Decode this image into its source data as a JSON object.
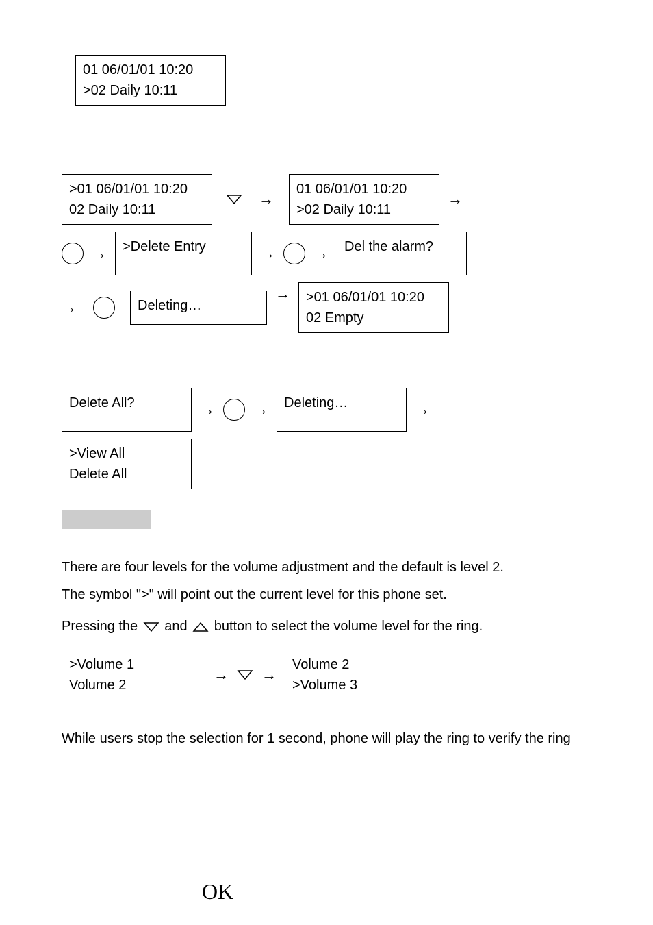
{
  "box_top": {
    "line1": "  01 06/01/01  10:20",
    "line2": ">02 Daily         10:11"
  },
  "flow1": {
    "b1_l1": ">01 06/01/01  10:20",
    "b1_l2": "  02 Daily        10:11",
    "b2_l1": "  01 06/01/01  10:20",
    "b2_l2": ">02 Daily 10:11"
  },
  "flow2": {
    "b1": ">Delete Entry",
    "b2": "Del the alarm?"
  },
  "flow3": {
    "b1": "Deleting…",
    "b2_l1": ">01 06/01/01  10:20",
    "b2_l2": "  02 Empty"
  },
  "flow4": {
    "b1": "Delete All?",
    "b2": "Deleting…"
  },
  "flow5": {
    "l1": ">View All",
    "l2": "  Delete All"
  },
  "para1": "There are four levels for the volume adjustment and the default is level 2.",
  "para2": "The symbol \">\" will point out the current level for this phone set.",
  "para3_a": "Pressing the ",
  "para3_b": " and ",
  "para3_c": " button to select the volume level for the ring.",
  "volume": {
    "b1_l1": ">Volume 1",
    "b1_l2": "  Volume 2",
    "b2_l1": "  Volume 2",
    "b2_l2": ">Volume 3"
  },
  "para4": "While users stop the selection for 1 second, phone will play the ring to verify the ring",
  "arrow": "→",
  "ok": "OK"
}
